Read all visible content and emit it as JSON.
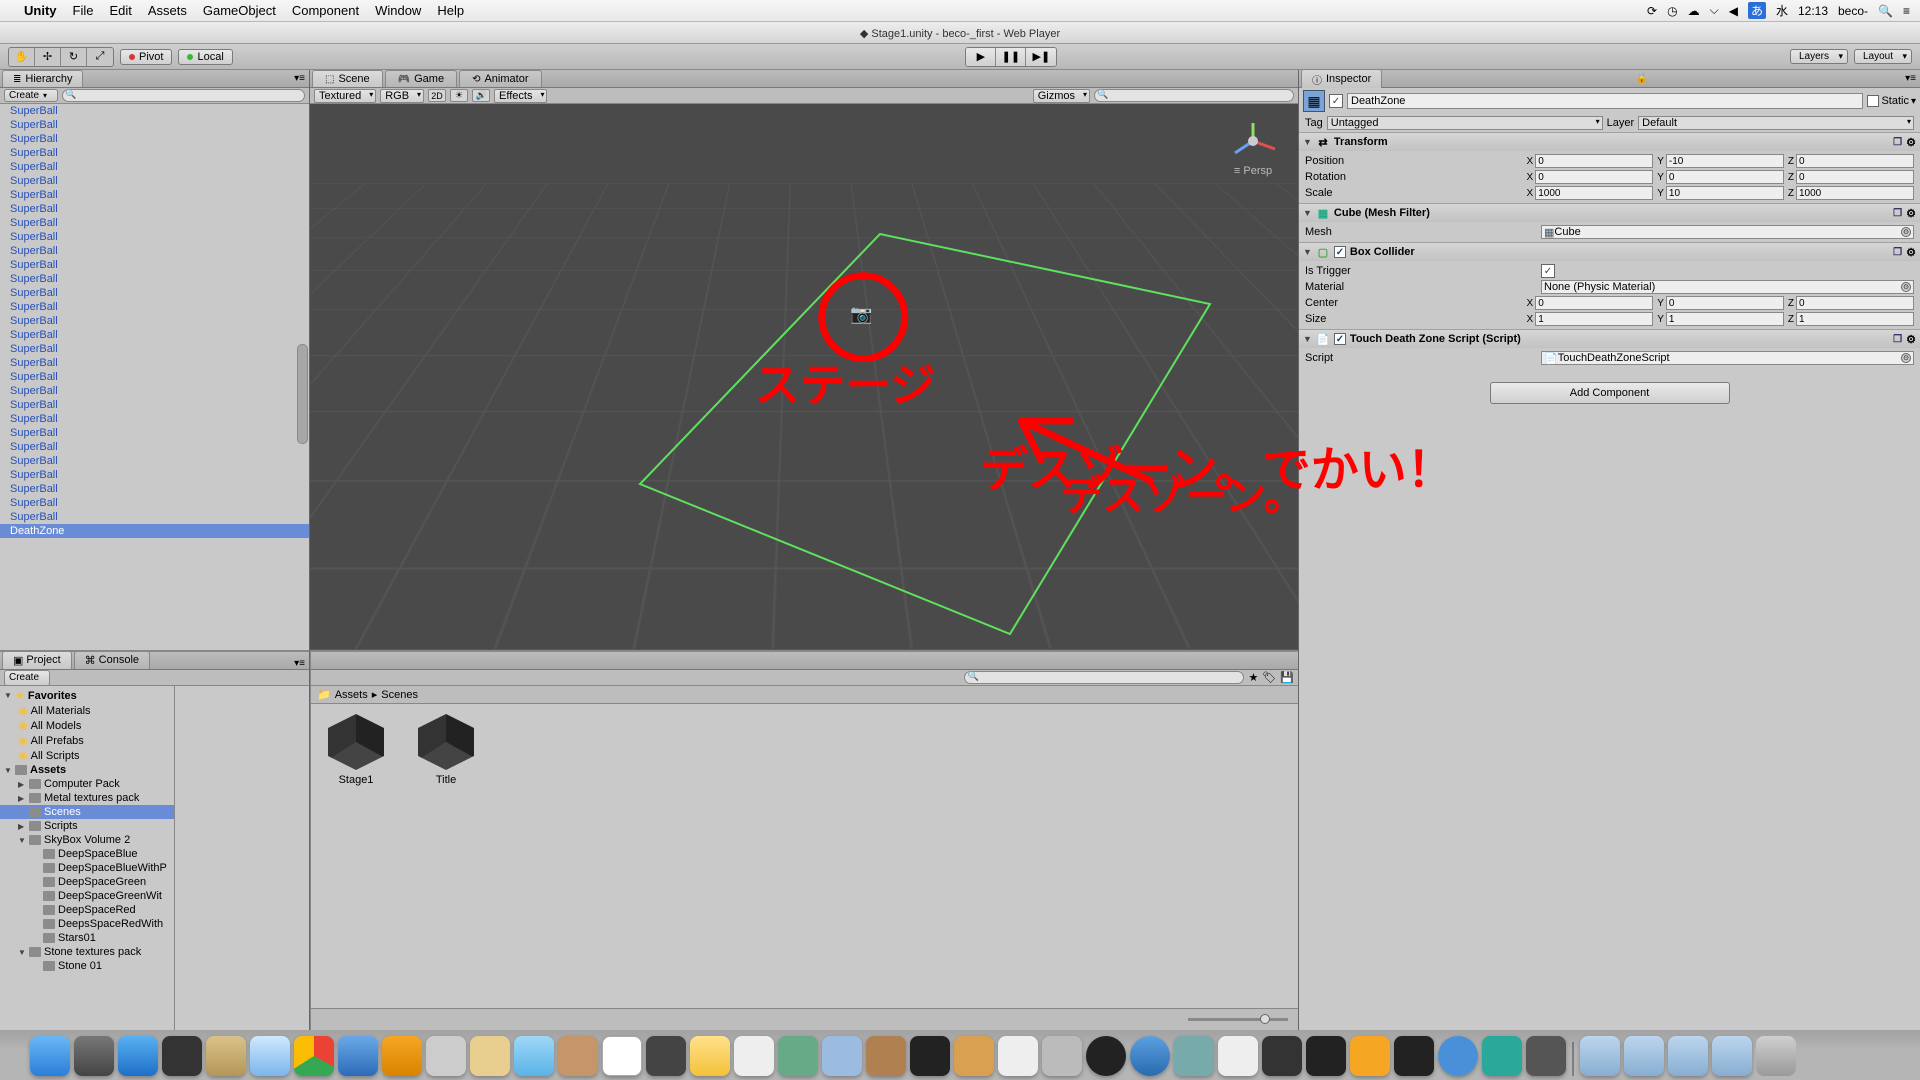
{
  "mac_menu": {
    "app": "Unity",
    "items": [
      "File",
      "Edit",
      "Assets",
      "GameObject",
      "Component",
      "Window",
      "Help"
    ],
    "tray_day": "水",
    "tray_time": "12:13",
    "tray_user": "beco-"
  },
  "window_title": "Stage1.unity - beco-_first - Web Player",
  "toolbar": {
    "pivot": "Pivot",
    "local": "Local",
    "layers": "Layers",
    "layout": "Layout"
  },
  "hierarchy": {
    "tab": "Hierarchy",
    "create": "Create",
    "items": [
      "SuperBall",
      "SuperBall",
      "SuperBall",
      "SuperBall",
      "SuperBall",
      "SuperBall",
      "SuperBall",
      "SuperBall",
      "SuperBall",
      "SuperBall",
      "SuperBall",
      "SuperBall",
      "SuperBall",
      "SuperBall",
      "SuperBall",
      "SuperBall",
      "SuperBall",
      "SuperBall",
      "SuperBall",
      "SuperBall",
      "SuperBall",
      "SuperBall",
      "SuperBall",
      "SuperBall",
      "SuperBall",
      "SuperBall",
      "SuperBall",
      "SuperBall",
      "SuperBall",
      "SuperBall"
    ],
    "selected": "DeathZone"
  },
  "center": {
    "tabs": {
      "scene": "Scene",
      "game": "Game",
      "animator": "Animator"
    },
    "shading": "Textured",
    "render": "RGB",
    "mode2d": "2D",
    "effects": "Effects",
    "gizmos": "Gizmos",
    "persp_label": "Persp"
  },
  "project": {
    "tab": "Project",
    "console_tab": "Console",
    "create": "Create",
    "favorites_header": "Favorites",
    "favorites": [
      "All Materials",
      "All Models",
      "All Prefabs",
      "All Scripts"
    ],
    "assets_header": "Assets",
    "tree": [
      "Computer Pack",
      "Metal textures pack",
      "Scenes",
      "Scripts",
      "SkyBox Volume 2",
      "DeepSpaceBlue",
      "DeepSpaceBlueWithP",
      "DeepSpaceGreen",
      "DeepSpaceGreenWit",
      "DeepSpaceRed",
      "DeepsSpaceRedWith",
      "Stars01",
      "Stone textures pack",
      "Stone 01"
    ],
    "breadcrumb": [
      "Assets",
      "Scenes"
    ],
    "items": [
      "Stage1",
      "Title"
    ]
  },
  "inspector": {
    "tab": "Inspector",
    "obj_name": "DeathZone",
    "static_label": "Static",
    "tag_label": "Tag",
    "tag_value": "Untagged",
    "layer_label": "Layer",
    "layer_value": "Default",
    "transform": {
      "title": "Transform",
      "position": {
        "label": "Position",
        "x": "0",
        "y": "-10",
        "z": "0"
      },
      "rotation": {
        "label": "Rotation",
        "x": "0",
        "y": "0",
        "z": "0"
      },
      "scale": {
        "label": "Scale",
        "x": "1000",
        "y": "10",
        "z": "1000"
      }
    },
    "mesh_filter": {
      "title": "Cube (Mesh Filter)",
      "mesh_label": "Mesh",
      "mesh_value": "Cube"
    },
    "box_collider": {
      "title": "Box Collider",
      "is_trigger_label": "Is Trigger",
      "is_trigger": true,
      "material_label": "Material",
      "material_value": "None (Physic Material)",
      "center": {
        "label": "Center",
        "x": "0",
        "y": "0",
        "z": "0"
      },
      "size": {
        "label": "Size",
        "x": "1",
        "y": "1",
        "z": "1"
      }
    },
    "script_comp": {
      "title": "Touch Death Zone Script (Script)",
      "script_label": "Script",
      "script_value": "TouchDeathZoneScript"
    },
    "add_component": "Add Component"
  },
  "annotations": {
    "stage": "ステージ",
    "deathzone": "デスゾーン。でかい！"
  }
}
